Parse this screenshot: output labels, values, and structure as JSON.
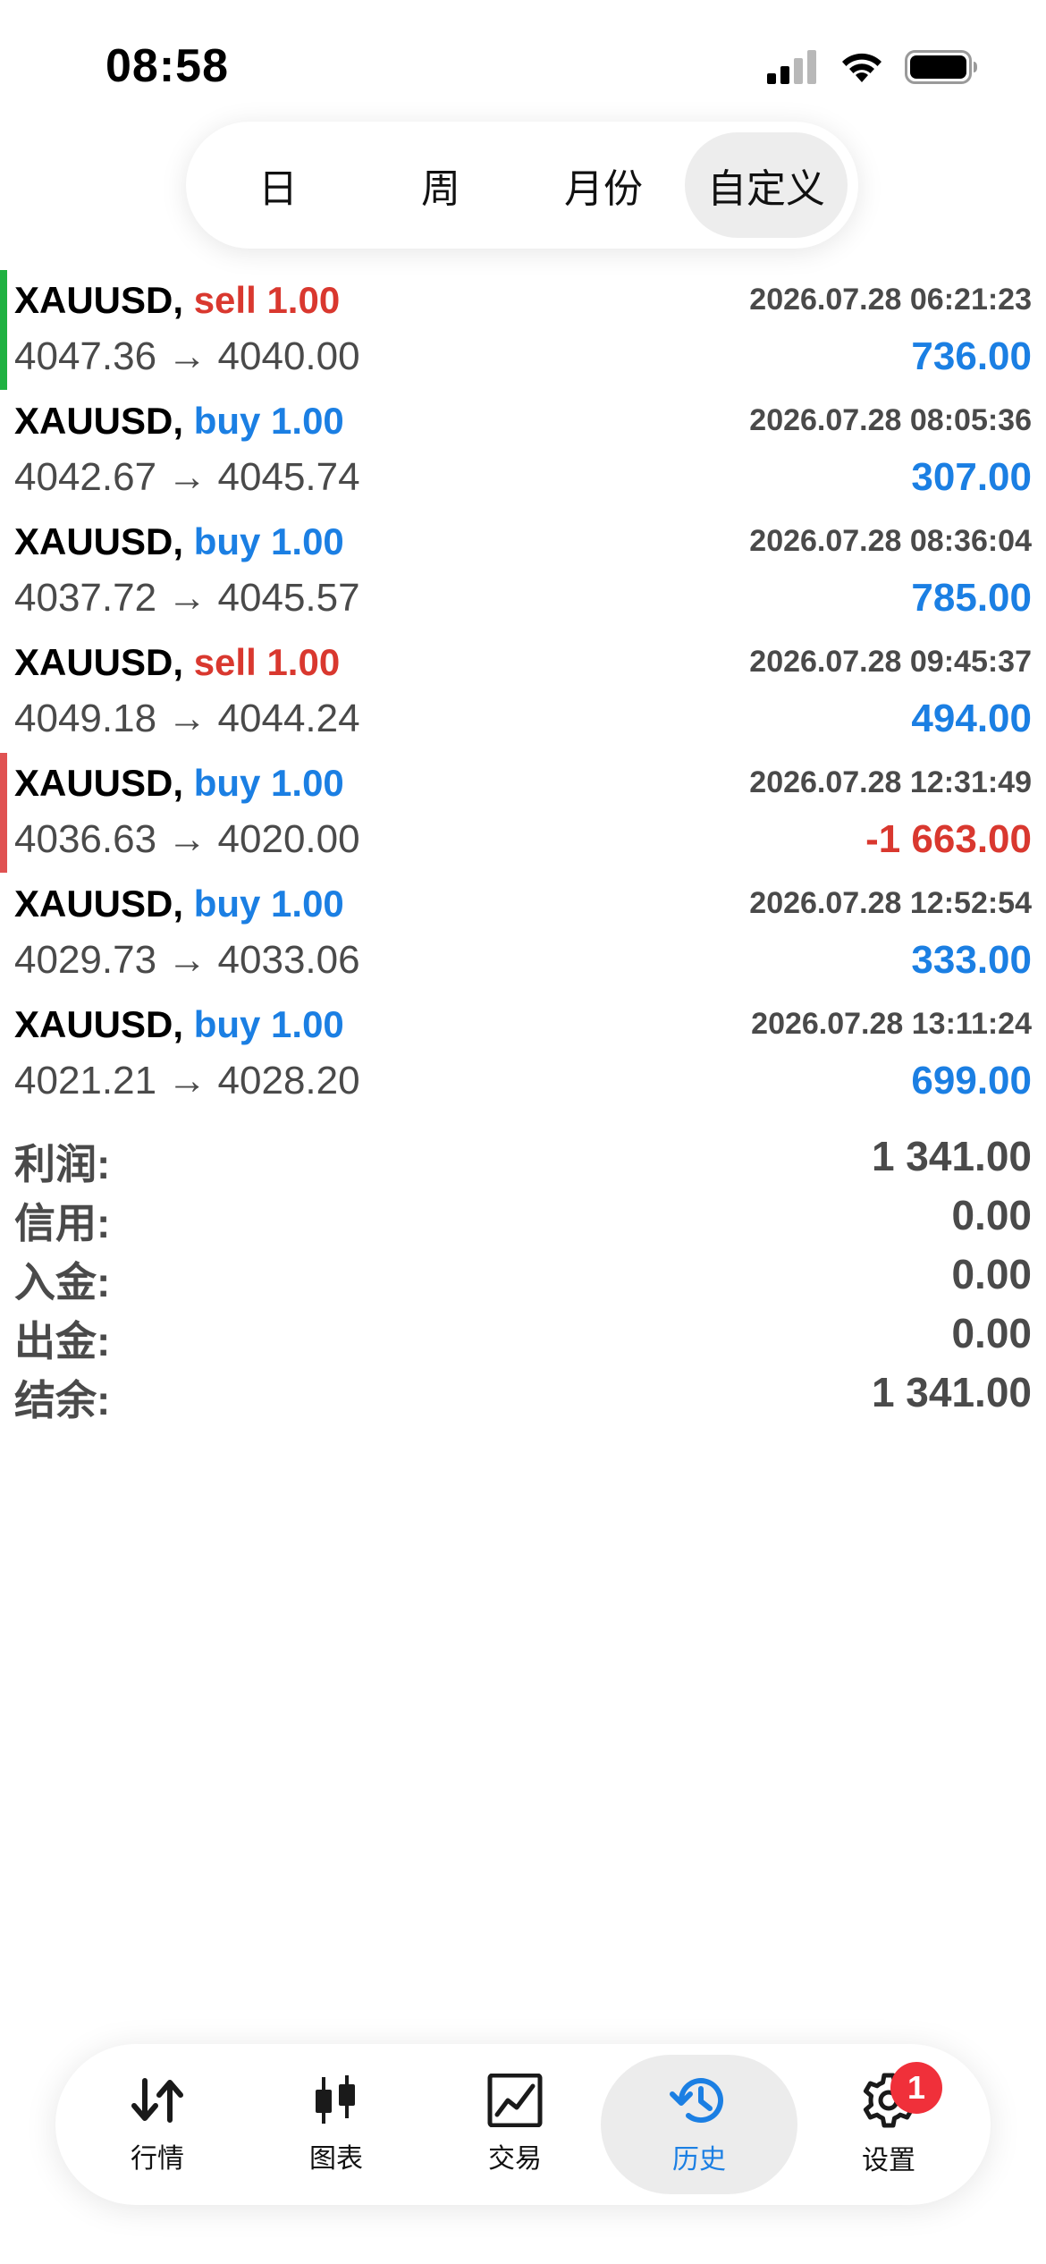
{
  "status_bar": {
    "time": "08:58"
  },
  "period_tabs": [
    {
      "label": "日",
      "active": false
    },
    {
      "label": "周",
      "active": false
    },
    {
      "label": "月份",
      "active": false
    },
    {
      "label": "自定义",
      "active": true
    }
  ],
  "trades": [
    {
      "symbol": "XAUUSD,",
      "side": "sell",
      "volume": "1.00",
      "time": "2026.07.28 06:21:23",
      "open_price": "4047.36",
      "arrow": "→",
      "close_price": "4040.00",
      "profit": "736.00",
      "indicator": "green"
    },
    {
      "symbol": "XAUUSD,",
      "side": "buy",
      "volume": "1.00",
      "time": "2026.07.28 08:05:36",
      "open_price": "4042.67",
      "arrow": "→",
      "close_price": "4045.74",
      "profit": "307.00",
      "indicator": "none"
    },
    {
      "symbol": "XAUUSD,",
      "side": "buy",
      "volume": "1.00",
      "time": "2026.07.28 08:36:04",
      "open_price": "4037.72",
      "arrow": "→",
      "close_price": "4045.57",
      "profit": "785.00",
      "indicator": "none"
    },
    {
      "symbol": "XAUUSD,",
      "side": "sell",
      "volume": "1.00",
      "time": "2026.07.28 09:45:37",
      "open_price": "4049.18",
      "arrow": "→",
      "close_price": "4044.24",
      "profit": "494.00",
      "indicator": "none"
    },
    {
      "symbol": "XAUUSD,",
      "side": "buy",
      "volume": "1.00",
      "time": "2026.07.28 12:31:49",
      "open_price": "4036.63",
      "arrow": "→",
      "close_price": "4020.00",
      "profit": "-1 663.00",
      "indicator": "red"
    },
    {
      "symbol": "XAUUSD,",
      "side": "buy",
      "volume": "1.00",
      "time": "2026.07.28 12:52:54",
      "open_price": "4029.73",
      "arrow": "→",
      "close_price": "4033.06",
      "profit": "333.00",
      "indicator": "none"
    },
    {
      "symbol": "XAUUSD,",
      "side": "buy",
      "volume": "1.00",
      "time": "2026.07.28 13:11:24",
      "open_price": "4021.21",
      "arrow": "→",
      "close_price": "4028.20",
      "profit": "699.00",
      "indicator": "none"
    }
  ],
  "summary": {
    "profit": {
      "label": "利润:",
      "value": "1 341.00"
    },
    "credit": {
      "label": "信用:",
      "value": "0.00"
    },
    "deposit": {
      "label": "入金:",
      "value": "0.00"
    },
    "withdrawal": {
      "label": "出金:",
      "value": "0.00"
    },
    "balance": {
      "label": "结余:",
      "value": "1 341.00"
    }
  },
  "tab_bar": {
    "items": [
      {
        "label": "行情",
        "icon": "quotes-arrows-icon",
        "active": false
      },
      {
        "label": "图表",
        "icon": "candlestick-chart-icon",
        "active": false
      },
      {
        "label": "交易",
        "icon": "trade-line-chart-icon",
        "active": false
      },
      {
        "label": "历史",
        "icon": "history-clock-icon",
        "active": true
      },
      {
        "label": "设置",
        "icon": "gear-icon",
        "active": false,
        "badge": "1"
      }
    ]
  },
  "colors": {
    "buy": "#1b7fe3",
    "sell": "#d9382f",
    "profit_positive": "#1b7fe3",
    "profit_negative": "#d9382f",
    "indicator_green": "#1fb141",
    "indicator_red": "#e05252",
    "badge": "#f0303a"
  }
}
